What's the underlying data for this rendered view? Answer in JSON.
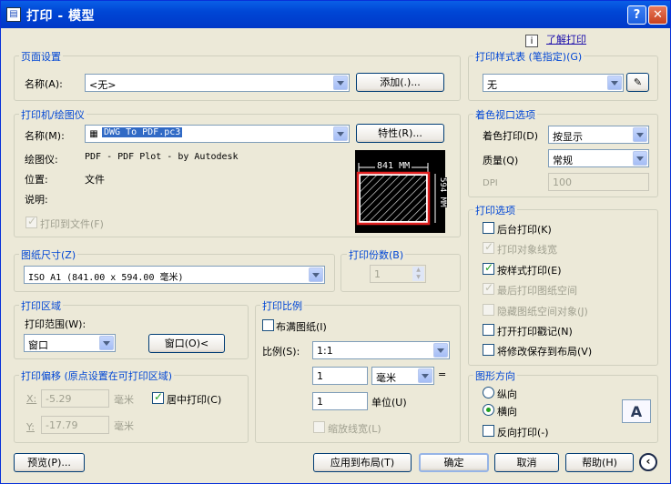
{
  "window": {
    "title": "打印 - 模型",
    "app_icon": "autocad-plot-icon"
  },
  "top_link": "了解打印",
  "page_setup": {
    "group_label": "页面设置",
    "name_label": "名称(A):",
    "name_value": "<无>",
    "add_button": "添加(.)..."
  },
  "printer": {
    "group_label": "打印机/绘图仪",
    "name_label": "名称(M):",
    "name_value": "DWG To PDF.pc3",
    "properties_button": "特性(R)...",
    "plotter_label": "绘图仪:",
    "plotter_value": "PDF - PDF Plot - by Autodesk",
    "location_label": "位置:",
    "location_value": "文件",
    "description_label": "说明:",
    "print_to_file_label": "打印到文件(F)",
    "preview_width": "841 MM",
    "preview_height": "594 MM"
  },
  "paper_size": {
    "group_label": "图纸尺寸(Z)",
    "value": "ISO A1 (841.00 x 594.00 毫米)"
  },
  "copies": {
    "group_label": "打印份数(B)",
    "value": "1"
  },
  "plot_area": {
    "group_label": "打印区域",
    "range_label": "打印范围(W):",
    "range_value": "窗口",
    "window_button": "窗口(O)<"
  },
  "plot_offset": {
    "group_label": "打印偏移 (原点设置在可打印区域)",
    "x_label": "X:",
    "x_value": "-5.29",
    "x_unit": "毫米",
    "center_label": "居中打印(C)",
    "y_label": "Y:",
    "y_value": "-17.79",
    "y_unit": "毫米"
  },
  "plot_scale": {
    "group_label": "打印比例",
    "fit_label": "布满图纸(I)",
    "scale_label": "比例(S):",
    "scale_value": "1:1",
    "mm_value": "1",
    "mm_unit": "毫米",
    "equals": "=",
    "unit_value": "1",
    "unit_label": "单位(U)",
    "scale_lineweights": "缩放线宽(L)"
  },
  "plot_style_table": {
    "group_label": "打印样式表 (笔指定)(G)",
    "value": "无"
  },
  "shaded_viewport": {
    "group_label": "着色视口选项",
    "shade_label": "着色打印(D)",
    "shade_value": "按显示",
    "quality_label": "质量(Q)",
    "quality_value": "常规",
    "dpi_label": "DPI",
    "dpi_value": "100"
  },
  "plot_options": {
    "group_label": "打印选项",
    "items": [
      {
        "label": "后台打印(K)"
      },
      {
        "label": "打印对象线宽"
      },
      {
        "label": "按样式打印(E)"
      },
      {
        "label": "最后打印图纸空间"
      },
      {
        "label": "隐藏图纸空间对象(J)"
      },
      {
        "label": "打开打印戳记(N)"
      },
      {
        "label": "将修改保存到布局(V)"
      }
    ]
  },
  "orientation": {
    "group_label": "图形方向",
    "portrait": "纵向",
    "landscape": "横向",
    "upside_down": "反向打印(-)",
    "icon_letter": "A"
  },
  "footer": {
    "preview_button": "预览(P)...",
    "apply_button": "应用到布局(T)",
    "ok_button": "确定",
    "cancel_button": "取消",
    "help_button": "帮助(H)"
  }
}
